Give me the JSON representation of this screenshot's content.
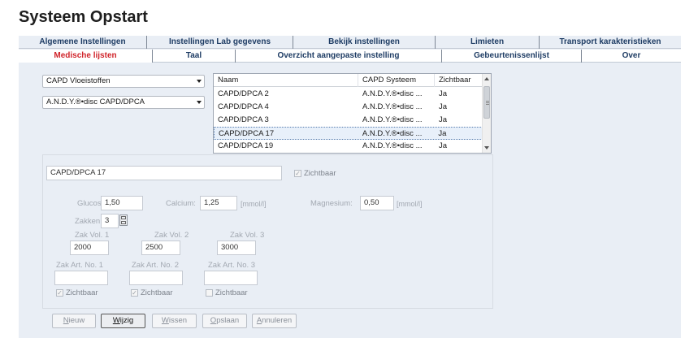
{
  "title": "Systeem Opstart",
  "tabs_row1": [
    "Algemene Instellingen",
    "Instellingen Lab gegevens",
    "Bekijk instellingen",
    "Limieten",
    "Transport karakteristieken"
  ],
  "tabs_row2": [
    "Medische lijsten",
    "Taal",
    "Overzicht aangepaste instelling",
    "Gebeurtenissenlijst",
    "Over"
  ],
  "active_tab": "Medische lijsten",
  "dropdowns": {
    "list_type": "CAPD Vloeistoffen",
    "system": "A.N.D.Y.®•disc CAPD/DPCA"
  },
  "table": {
    "headers": [
      "Naam",
      "CAPD Systeem",
      "Zichtbaar"
    ],
    "rows": [
      [
        "CAPD/DPCA 2",
        "A.N.D.Y.®•disc ...",
        "Ja"
      ],
      [
        "CAPD/DPCA 4",
        "A.N.D.Y.®•disc ...",
        "Ja"
      ],
      [
        "CAPD/DPCA 3",
        "A.N.D.Y.®•disc ...",
        "Ja"
      ],
      [
        "CAPD/DPCA 17",
        "A.N.D.Y.®•disc ...",
        "Ja"
      ],
      [
        "CAPD/DPCA 19",
        "A.N.D.Y.®•disc ...",
        "Ja"
      ]
    ],
    "selected_row": 3
  },
  "detail": {
    "name": "CAPD/DPCA 17",
    "zichtbaar_label": "Zichtbaar",
    "glucose_label": "Glucose:",
    "glucose_value": "1,50",
    "calcium_label": "Calcium:",
    "calcium_value": "1,25",
    "calcium_unit": "[mmol/l]",
    "magnesium_label": "Magnesium:",
    "magnesium_value": "0,50",
    "magnesium_unit": "[mmol/l]",
    "zakken_label": "Zakken",
    "zakken_value": "3",
    "zak_vol_labels": [
      "Zak Vol. 1",
      "Zak Vol. 2",
      "Zak Vol. 3"
    ],
    "zak_vol_values": [
      "2000",
      "2500",
      "3000"
    ],
    "zak_art_labels": [
      "Zak Art. No. 1",
      "Zak Art. No. 2",
      "Zak Art. No. 3"
    ],
    "zak_art_values": [
      "",
      "",
      ""
    ],
    "zak_zichtbaar_label": "Zichtbaar",
    "check_mark": "✓"
  },
  "buttons": {
    "nieuw": {
      "first": "N",
      "rest": "ieuw"
    },
    "wijzig": {
      "first": "W",
      "rest": "ijzig"
    },
    "wissen": {
      "first": "W",
      "rest": "issen"
    },
    "opslaan": {
      "first": "O",
      "rest": "pslaan"
    },
    "annuleren": {
      "first": "A",
      "rest": "nnuleren"
    }
  }
}
